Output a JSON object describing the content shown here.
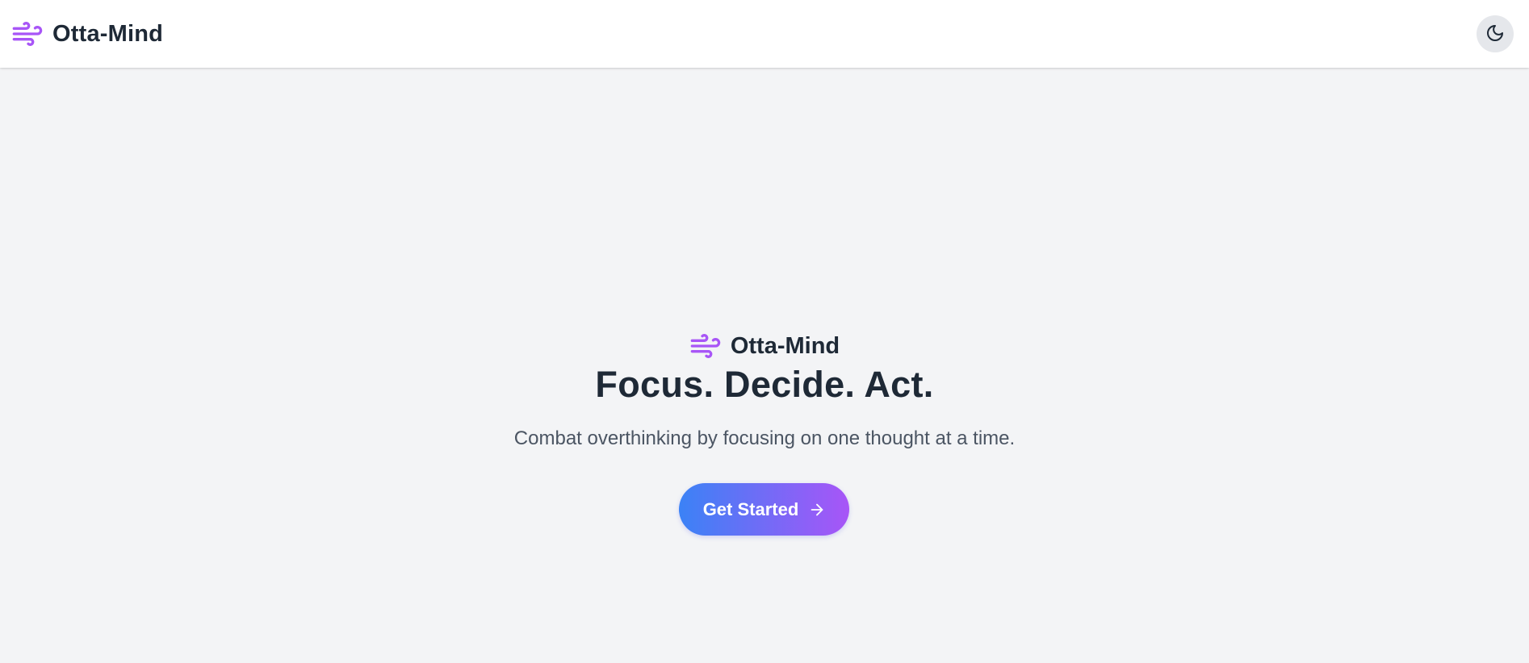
{
  "header": {
    "brand_name": "Otta-Mind",
    "logo_icon": "wind-icon",
    "theme_toggle_icon": "moon-icon"
  },
  "hero": {
    "brand_name": "Otta-Mind",
    "logo_icon": "wind-icon",
    "title": "Focus. Decide. Act.",
    "subtitle": "Combat overthinking by focusing on one thought at a time.",
    "cta_label": "Get Started",
    "cta_icon": "arrow-right-icon"
  },
  "colors": {
    "accent_purple": "#a855f7",
    "gradient_start": "#3b82f6",
    "gradient_end": "#a855f7",
    "page_background": "#f3f4f6",
    "text_dark": "#1e2936",
    "text_muted": "#4b5563"
  }
}
